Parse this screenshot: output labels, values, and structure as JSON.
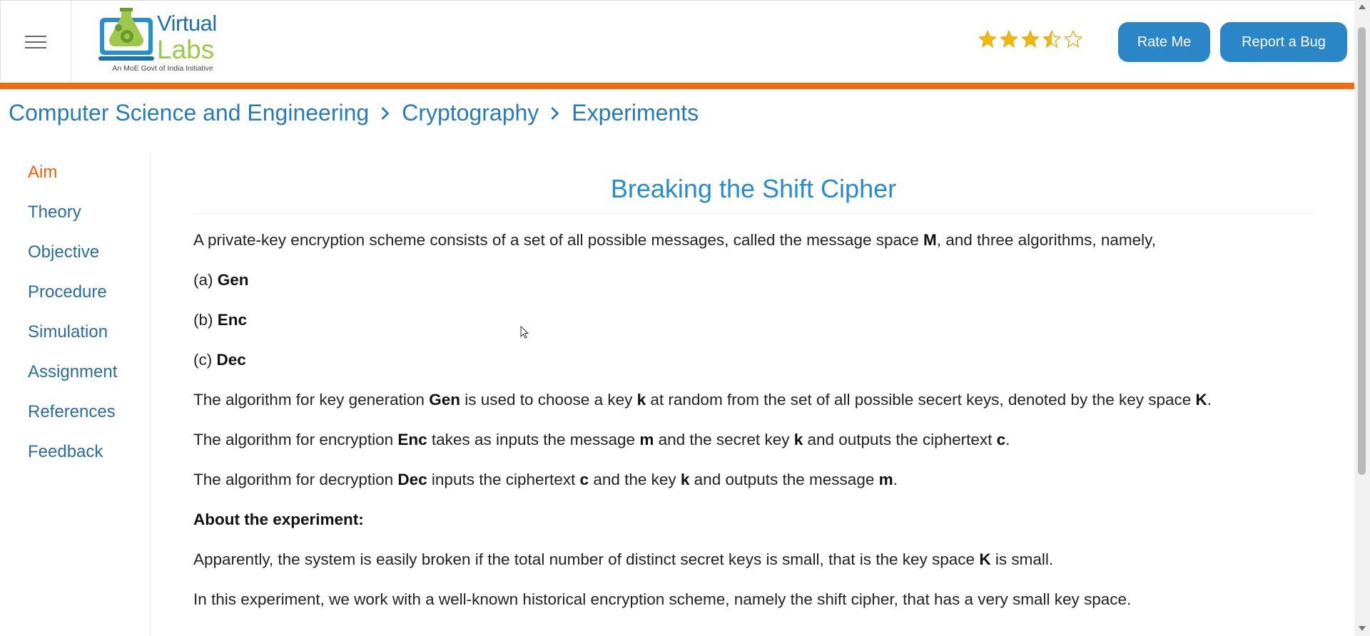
{
  "header": {
    "logo": {
      "line1": "Virtual",
      "line2": "Labs",
      "tagline": "An MoE Govt of India Initiative"
    },
    "rating": {
      "value": 3.5,
      "max": 5,
      "star_color": "#f2b90c"
    },
    "buttons": {
      "rate": "Rate Me",
      "report": "Report a Bug"
    }
  },
  "breadcrumb": [
    "Computer Science and Engineering",
    "Cryptography",
    "Experiments"
  ],
  "sidebar": {
    "items": [
      {
        "label": "Aim",
        "active": true
      },
      {
        "label": "Theory"
      },
      {
        "label": "Objective"
      },
      {
        "label": "Procedure"
      },
      {
        "label": "Simulation"
      },
      {
        "label": "Assignment"
      },
      {
        "label": "References"
      },
      {
        "label": "Feedback"
      }
    ]
  },
  "content": {
    "title": "Breaking the Shift Cipher",
    "p1": {
      "pre": "A private-key encryption scheme consists of a set of all possible messages, called the message space ",
      "b1": "M",
      "post": ", and three algorithms, namely,"
    },
    "list": [
      {
        "prefix": "(a) ",
        "term": "Gen"
      },
      {
        "prefix": "(b) ",
        "term": "Enc"
      },
      {
        "prefix": "(c) ",
        "term": "Dec"
      }
    ],
    "p_gen": {
      "t1": "The algorithm for key generation ",
      "b1": "Gen",
      "t2": " is used to choose a key ",
      "b2": "k",
      "t3": " at random from the set of all possible secert keys, denoted by the key space ",
      "b3": "K",
      "t4": "."
    },
    "p_enc": {
      "t1": "The algorithm for encryption ",
      "b1": "Enc",
      "t2": " takes as inputs the message ",
      "b2": "m",
      "t3": " and the secret key ",
      "b3": "k",
      "t4": " and outputs the ciphertext ",
      "b4": "c",
      "t5": "."
    },
    "p_dec": {
      "t1": "The algorithm for decryption ",
      "b1": "Dec",
      "t2": " inputs the ciphertext ",
      "b2": "c",
      "t3": " and the key ",
      "b3": "k",
      "t4": " and outputs the message ",
      "b4": "m",
      "t5": "."
    },
    "about_heading": "About the experiment:",
    "p_about1": {
      "t1": "Apparently, the system is easily broken if the total number of distinct secret keys is small, that is the key space ",
      "b1": "K",
      "t2": " is small."
    },
    "p_about2": "In this experiment, we work with a well-known historical encryption scheme, namely the shift cipher, that has a very small key space."
  },
  "colors": {
    "accent_orange": "#f26a10",
    "button_blue": "#2a86c6",
    "link_blue": "#2b7ab3"
  }
}
